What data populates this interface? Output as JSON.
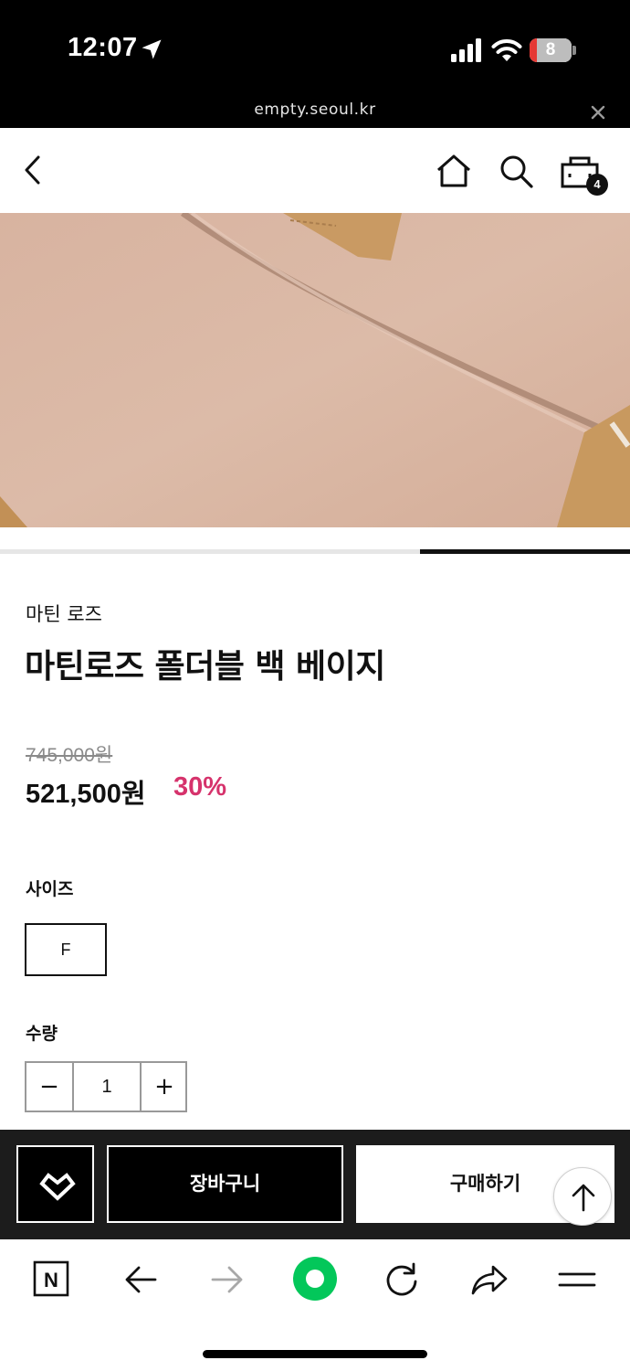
{
  "status_bar": {
    "time": "12:07",
    "battery_level": "8",
    "icons": [
      "location-arrow-icon",
      "signal-icon",
      "wifi-icon",
      "battery-icon"
    ]
  },
  "url_bar": {
    "url": "empty.seoul.kr",
    "close_icon": "close-icon"
  },
  "header": {
    "back_icon": "chevron-left-icon",
    "home_icon": "home-icon",
    "search_icon": "search-icon",
    "cart_icon": "cart-icon",
    "cart_count": "4"
  },
  "gallery": {
    "slider_position": {
      "slide": 3,
      "total": 3
    }
  },
  "product": {
    "brand": "마틴 로즈",
    "title": "마틴로즈 폴더블 백 베이지",
    "price_original": "745,000원",
    "price_sale": "521,500원",
    "discount": "30%"
  },
  "options": {
    "size_label": "사이즈",
    "sizes": [
      "F"
    ],
    "quantity_label": "수량",
    "quantity": "1",
    "decrement_symbol": "−",
    "increment_symbol": "+"
  },
  "purchase_bar": {
    "wishlist_icon": "heart-icon",
    "cart_label": "장바구니",
    "buy_label": "구매하기",
    "scroll_top_icon": "arrow-up-icon"
  },
  "browser_toolbar": {
    "naver_logo": "N",
    "icons": [
      "naver-icon",
      "back-arrow-icon",
      "forward-arrow-icon",
      "green-dot-icon",
      "reload-icon",
      "share-icon",
      "menu-icon"
    ]
  },
  "colors": {
    "discount": "#d6336c",
    "bar_background": "#1c1c1c",
    "status_bar": "#000000",
    "browser_green": "#03c75a"
  }
}
